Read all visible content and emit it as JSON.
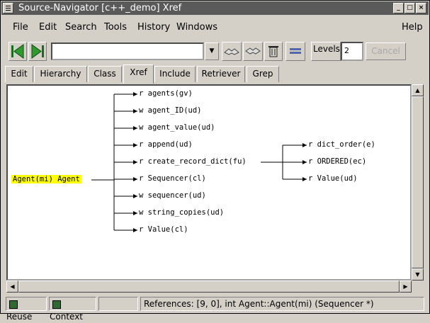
{
  "window": {
    "title": "Source-Navigator [c++_demo] Xref"
  },
  "menu": [
    "File",
    "Edit",
    "Search",
    "Tools",
    "History",
    "Windows",
    "Help"
  ],
  "toolbar": {
    "levels_label": "Levels",
    "levels_value": "2",
    "cancel_label": "Cancel",
    "combo_value": ""
  },
  "tabs": [
    "Edit",
    "Hierarchy",
    "Class",
    "Xref",
    "Include",
    "Retriever",
    "Grep"
  ],
  "active_tab": "Xref",
  "xref": {
    "root": "Agent(mi) Agent",
    "children": [
      "r agents(gv)",
      "w agent_ID(ud)",
      "w agent_value(ud)",
      "r append(ud)",
      "r create_record_dict(fu)",
      "r Sequencer(cl)",
      "w sequencer(ud)",
      "w string_copies(ud)",
      "r Value(cl)"
    ],
    "grandchildren": [
      "r dict_order(e)",
      "r ORDERED(ec)",
      "r Value(ud)"
    ]
  },
  "status": {
    "reuse_label": "Reuse",
    "context_label": "Context",
    "message": "References: [9, 0], int  Agent::Agent(mi) (Sequencer *)"
  },
  "colors": {
    "root_highlight": "#ffff00",
    "title_bar": "#5a5a5a"
  }
}
